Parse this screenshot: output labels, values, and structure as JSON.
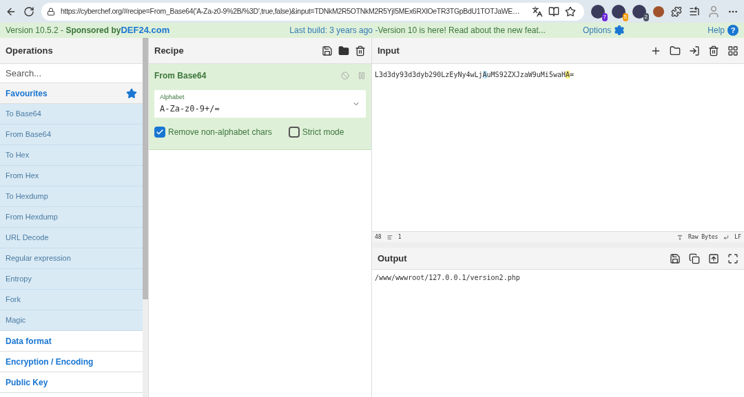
{
  "browser": {
    "url": "https://cyberchef.org/#recipe=From_Base64('A-Za-z0-9%2B/%3D',true,false)&input=TDNkM2R5OTNkM2R5YjI5MEx6RXlOeTR3TGpBdU1TOTJaWE…",
    "extension_badges": [
      "7",
      "5",
      "2"
    ]
  },
  "banner": {
    "version": "Version 10.5.2 - ",
    "sponsor_prefix": "Sponsored by ",
    "sponsor": "DEF24.com",
    "build": "Last build: 3 years ago - ",
    "news": "Version 10 is here! Read about the new feat...",
    "options": "Options",
    "help": "Help",
    "help_icon": "?"
  },
  "operations": {
    "title": "Operations",
    "search_placeholder": "Search...",
    "categories": [
      {
        "name": "Favourites",
        "expanded": true,
        "items": [
          "To Base64",
          "From Base64",
          "To Hex",
          "From Hex",
          "To Hexdump",
          "From Hexdump",
          "URL Decode",
          "Regular expression",
          "Entropy",
          "Fork",
          "Magic"
        ]
      },
      {
        "name": "Data format",
        "expanded": false
      },
      {
        "name": "Encryption / Encoding",
        "expanded": false
      },
      {
        "name": "Public Key",
        "expanded": false
      }
    ]
  },
  "recipe": {
    "title": "Recipe",
    "operation": {
      "name": "From Base64",
      "alphabet_label": "Alphabet",
      "alphabet": "A-Za-z0-9+/=",
      "options": [
        {
          "label": "Remove non-alphabet chars",
          "checked": true
        },
        {
          "label": "Strict mode",
          "checked": false
        }
      ]
    }
  },
  "input": {
    "title": "Input",
    "segments": [
      {
        "text": "L3d3dy93d3dyb290LzEyNy4wLj",
        "kind": "plain"
      },
      {
        "text": "A",
        "kind": "selection"
      },
      {
        "text": "uMS92ZXJzaW9uMi5waH",
        "kind": "plain"
      },
      {
        "text": "A",
        "kind": "match"
      },
      {
        "text": "=",
        "kind": "plain"
      }
    ],
    "length": "48",
    "lines": "1",
    "encoding": "Raw Bytes",
    "eol": "LF"
  },
  "output": {
    "title": "Output",
    "text": "/www/wwwroot/127.0.0.1/version2.php"
  }
}
